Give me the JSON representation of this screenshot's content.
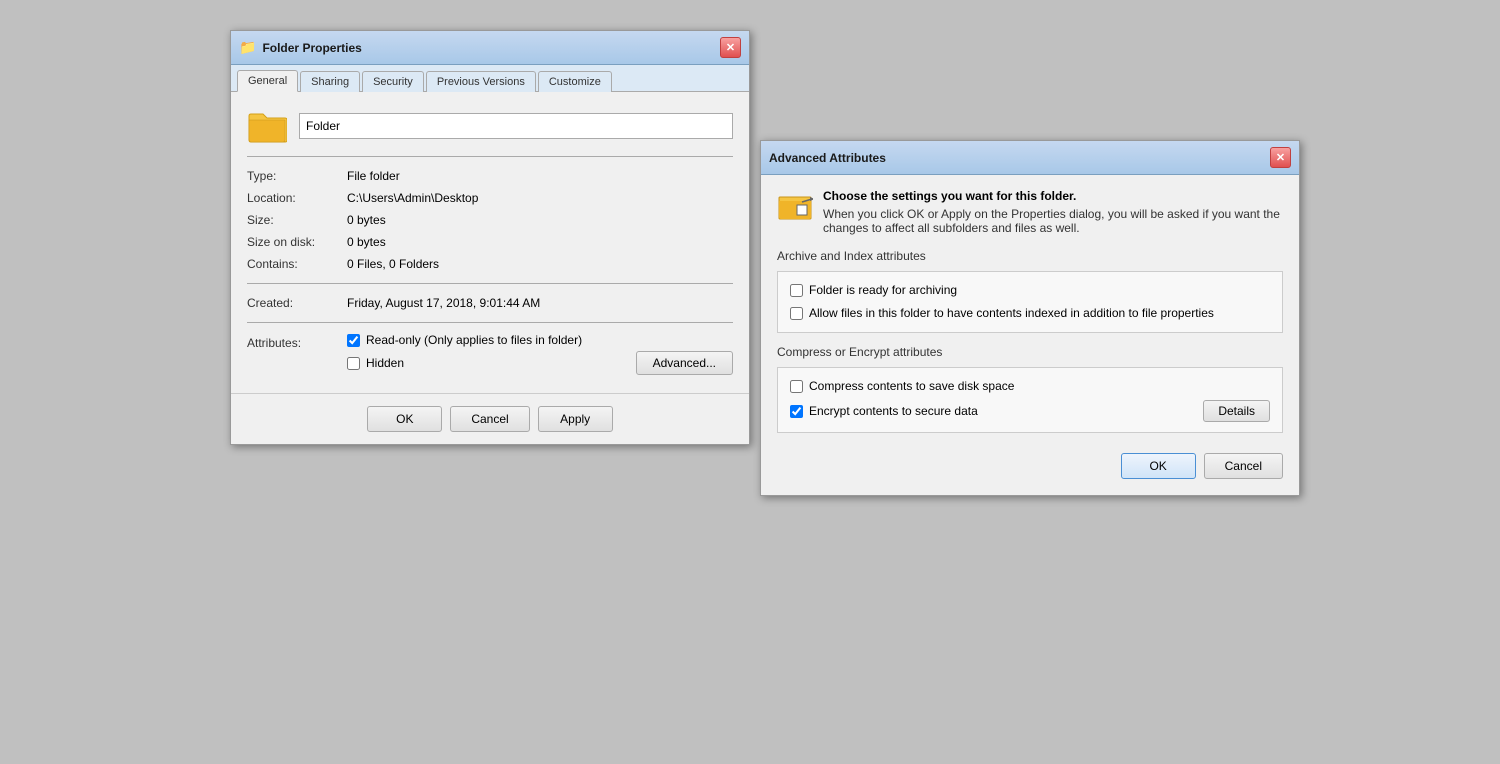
{
  "folderProps": {
    "title": "Folder Properties",
    "tabs": [
      {
        "label": "General",
        "active": true
      },
      {
        "label": "Sharing",
        "active": false
      },
      {
        "label": "Security",
        "active": false
      },
      {
        "label": "Previous Versions",
        "active": false
      },
      {
        "label": "Customize",
        "active": false
      }
    ],
    "folderName": "Folder",
    "fields": [
      {
        "label": "Type:",
        "value": "File folder"
      },
      {
        "label": "Location:",
        "value": "C:\\Users\\Admin\\Desktop"
      },
      {
        "label": "Size:",
        "value": "0 bytes"
      },
      {
        "label": "Size on disk:",
        "value": "0 bytes"
      },
      {
        "label": "Contains:",
        "value": "0 Files, 0 Folders"
      },
      {
        "label": "Created:",
        "value": "Friday, August 17, 2018, 9:01:44 AM"
      }
    ],
    "attributes": {
      "label": "Attributes:",
      "readonly_label": "Read-only (Only applies to files in folder)",
      "readonly_checked": true,
      "hidden_label": "Hidden",
      "hidden_checked": false,
      "advanced_button": "Advanced..."
    },
    "buttons": {
      "ok": "OK",
      "cancel": "Cancel",
      "apply": "Apply"
    }
  },
  "advancedAttrs": {
    "title": "Advanced Attributes",
    "description_line1": "Choose the settings you want for this folder.",
    "description_line2": "When you click OK or Apply on the Properties dialog, you will be asked if you want the changes to affect all subfolders and files as well.",
    "archive_section": "Archive and Index attributes",
    "archive_check1_label": "Folder is ready for archiving",
    "archive_check1_checked": false,
    "archive_check2_label": "Allow files in this folder to have contents indexed in addition to file properties",
    "archive_check2_checked": false,
    "compress_section": "Compress or Encrypt attributes",
    "compress_check1_label": "Compress contents to save disk space",
    "compress_check1_checked": false,
    "compress_check2_label": "Encrypt contents to secure data",
    "compress_check2_checked": true,
    "details_button": "Details",
    "ok_button": "OK",
    "cancel_button": "Cancel"
  }
}
